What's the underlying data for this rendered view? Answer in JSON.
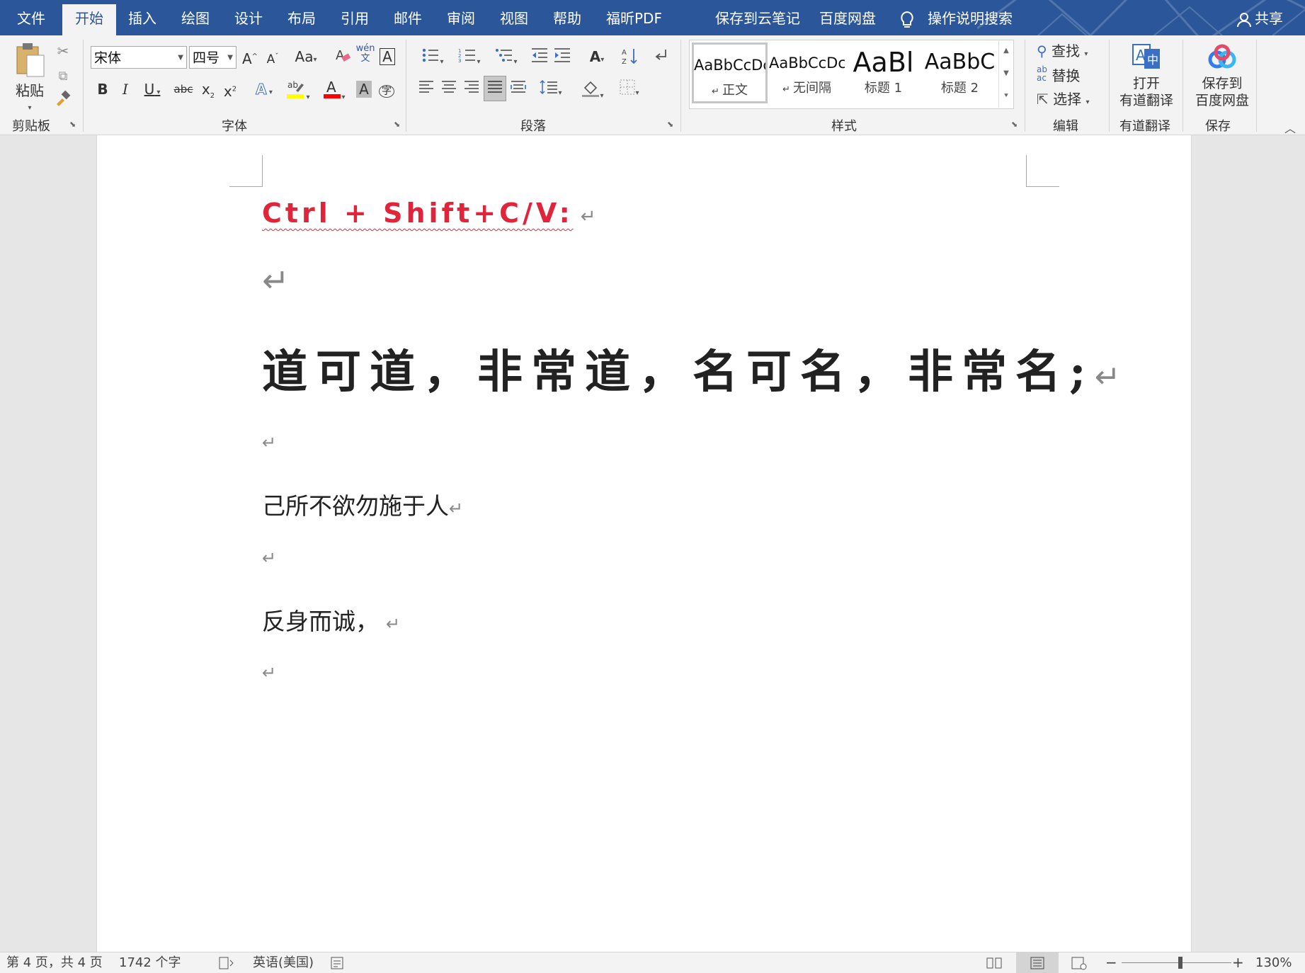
{
  "tabs": [
    "文件",
    "开始",
    "插入",
    "绘图",
    "设计",
    "布局",
    "引用",
    "邮件",
    "审阅",
    "视图",
    "帮助",
    "福昕PDF",
    "保存到云笔记",
    "百度网盘"
  ],
  "tell_me": "操作说明搜索",
  "share": "共享",
  "clipboard": {
    "paste": "粘贴",
    "label": "剪贴板"
  },
  "font": {
    "name": "宋体",
    "size": "四号",
    "label": "字体",
    "change_case": "Aa"
  },
  "paragraph": {
    "label": "段落"
  },
  "styles": {
    "label": "样式",
    "items": [
      {
        "sample": "AaBbCcDc",
        "name": "正文"
      },
      {
        "sample": "AaBbCcDc",
        "name": "无间隔"
      },
      {
        "sample": "AaBl",
        "name": "标题 1"
      },
      {
        "sample": "AaBbC",
        "name": "标题 2"
      }
    ]
  },
  "editing": {
    "find": "查找",
    "replace": "替换",
    "select": "选择",
    "label": "编辑"
  },
  "youdao": {
    "open_line1": "打开",
    "open_line2": "有道翻译",
    "label": "有道翻译"
  },
  "save": {
    "line1": "保存到",
    "line2": "百度网盘",
    "label": "保存"
  },
  "document": {
    "line1": "Ctrl + Shift+C/V:",
    "line2": "道可道，非常道，名可名，非常名;",
    "line3": "己所不欲勿施于人",
    "line4": "反身而诚，",
    "para_mark": "↵"
  },
  "status": {
    "page": "第 4 页，共 4 页",
    "words": "1742 个字",
    "language": "英语(美国)",
    "zoom": "130%",
    "zoom_level_percent": 130
  },
  "colors": {
    "accent": "#2b579a",
    "heading_red": "#e0243a",
    "highlight_yellow": "#ffff00",
    "font_red": "#ff0000"
  }
}
